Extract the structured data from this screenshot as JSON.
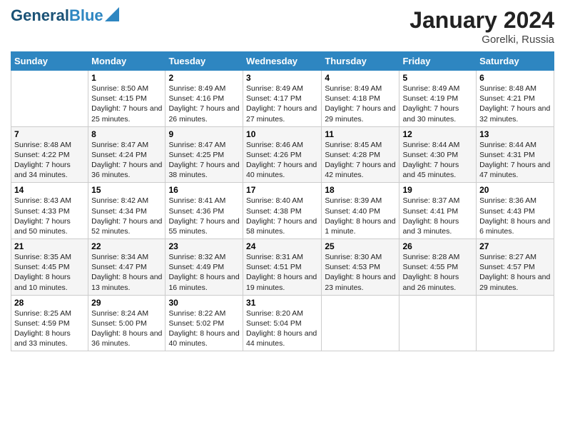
{
  "header": {
    "logo_line1": "General",
    "logo_line2": "Blue",
    "title": "January 2024",
    "subtitle": "Gorelki, Russia"
  },
  "days": [
    "Sunday",
    "Monday",
    "Tuesday",
    "Wednesday",
    "Thursday",
    "Friday",
    "Saturday"
  ],
  "weeks": [
    [
      {
        "date": "",
        "sunrise": "",
        "sunset": "",
        "daylight": ""
      },
      {
        "date": "1",
        "sunrise": "Sunrise: 8:50 AM",
        "sunset": "Sunset: 4:15 PM",
        "daylight": "Daylight: 7 hours and 25 minutes."
      },
      {
        "date": "2",
        "sunrise": "Sunrise: 8:49 AM",
        "sunset": "Sunset: 4:16 PM",
        "daylight": "Daylight: 7 hours and 26 minutes."
      },
      {
        "date": "3",
        "sunrise": "Sunrise: 8:49 AM",
        "sunset": "Sunset: 4:17 PM",
        "daylight": "Daylight: 7 hours and 27 minutes."
      },
      {
        "date": "4",
        "sunrise": "Sunrise: 8:49 AM",
        "sunset": "Sunset: 4:18 PM",
        "daylight": "Daylight: 7 hours and 29 minutes."
      },
      {
        "date": "5",
        "sunrise": "Sunrise: 8:49 AM",
        "sunset": "Sunset: 4:19 PM",
        "daylight": "Daylight: 7 hours and 30 minutes."
      },
      {
        "date": "6",
        "sunrise": "Sunrise: 8:48 AM",
        "sunset": "Sunset: 4:21 PM",
        "daylight": "Daylight: 7 hours and 32 minutes."
      }
    ],
    [
      {
        "date": "7",
        "sunrise": "Sunrise: 8:48 AM",
        "sunset": "Sunset: 4:22 PM",
        "daylight": "Daylight: 7 hours and 34 minutes."
      },
      {
        "date": "8",
        "sunrise": "Sunrise: 8:47 AM",
        "sunset": "Sunset: 4:24 PM",
        "daylight": "Daylight: 7 hours and 36 minutes."
      },
      {
        "date": "9",
        "sunrise": "Sunrise: 8:47 AM",
        "sunset": "Sunset: 4:25 PM",
        "daylight": "Daylight: 7 hours and 38 minutes."
      },
      {
        "date": "10",
        "sunrise": "Sunrise: 8:46 AM",
        "sunset": "Sunset: 4:26 PM",
        "daylight": "Daylight: 7 hours and 40 minutes."
      },
      {
        "date": "11",
        "sunrise": "Sunrise: 8:45 AM",
        "sunset": "Sunset: 4:28 PM",
        "daylight": "Daylight: 7 hours and 42 minutes."
      },
      {
        "date": "12",
        "sunrise": "Sunrise: 8:44 AM",
        "sunset": "Sunset: 4:30 PM",
        "daylight": "Daylight: 7 hours and 45 minutes."
      },
      {
        "date": "13",
        "sunrise": "Sunrise: 8:44 AM",
        "sunset": "Sunset: 4:31 PM",
        "daylight": "Daylight: 7 hours and 47 minutes."
      }
    ],
    [
      {
        "date": "14",
        "sunrise": "Sunrise: 8:43 AM",
        "sunset": "Sunset: 4:33 PM",
        "daylight": "Daylight: 7 hours and 50 minutes."
      },
      {
        "date": "15",
        "sunrise": "Sunrise: 8:42 AM",
        "sunset": "Sunset: 4:34 PM",
        "daylight": "Daylight: 7 hours and 52 minutes."
      },
      {
        "date": "16",
        "sunrise": "Sunrise: 8:41 AM",
        "sunset": "Sunset: 4:36 PM",
        "daylight": "Daylight: 7 hours and 55 minutes."
      },
      {
        "date": "17",
        "sunrise": "Sunrise: 8:40 AM",
        "sunset": "Sunset: 4:38 PM",
        "daylight": "Daylight: 7 hours and 58 minutes."
      },
      {
        "date": "18",
        "sunrise": "Sunrise: 8:39 AM",
        "sunset": "Sunset: 4:40 PM",
        "daylight": "Daylight: 8 hours and 1 minute."
      },
      {
        "date": "19",
        "sunrise": "Sunrise: 8:37 AM",
        "sunset": "Sunset: 4:41 PM",
        "daylight": "Daylight: 8 hours and 3 minutes."
      },
      {
        "date": "20",
        "sunrise": "Sunrise: 8:36 AM",
        "sunset": "Sunset: 4:43 PM",
        "daylight": "Daylight: 8 hours and 6 minutes."
      }
    ],
    [
      {
        "date": "21",
        "sunrise": "Sunrise: 8:35 AM",
        "sunset": "Sunset: 4:45 PM",
        "daylight": "Daylight: 8 hours and 10 minutes."
      },
      {
        "date": "22",
        "sunrise": "Sunrise: 8:34 AM",
        "sunset": "Sunset: 4:47 PM",
        "daylight": "Daylight: 8 hours and 13 minutes."
      },
      {
        "date": "23",
        "sunrise": "Sunrise: 8:32 AM",
        "sunset": "Sunset: 4:49 PM",
        "daylight": "Daylight: 8 hours and 16 minutes."
      },
      {
        "date": "24",
        "sunrise": "Sunrise: 8:31 AM",
        "sunset": "Sunset: 4:51 PM",
        "daylight": "Daylight: 8 hours and 19 minutes."
      },
      {
        "date": "25",
        "sunrise": "Sunrise: 8:30 AM",
        "sunset": "Sunset: 4:53 PM",
        "daylight": "Daylight: 8 hours and 23 minutes."
      },
      {
        "date": "26",
        "sunrise": "Sunrise: 8:28 AM",
        "sunset": "Sunset: 4:55 PM",
        "daylight": "Daylight: 8 hours and 26 minutes."
      },
      {
        "date": "27",
        "sunrise": "Sunrise: 8:27 AM",
        "sunset": "Sunset: 4:57 PM",
        "daylight": "Daylight: 8 hours and 29 minutes."
      }
    ],
    [
      {
        "date": "28",
        "sunrise": "Sunrise: 8:25 AM",
        "sunset": "Sunset: 4:59 PM",
        "daylight": "Daylight: 8 hours and 33 minutes."
      },
      {
        "date": "29",
        "sunrise": "Sunrise: 8:24 AM",
        "sunset": "Sunset: 5:00 PM",
        "daylight": "Daylight: 8 hours and 36 minutes."
      },
      {
        "date": "30",
        "sunrise": "Sunrise: 8:22 AM",
        "sunset": "Sunset: 5:02 PM",
        "daylight": "Daylight: 8 hours and 40 minutes."
      },
      {
        "date": "31",
        "sunrise": "Sunrise: 8:20 AM",
        "sunset": "Sunset: 5:04 PM",
        "daylight": "Daylight: 8 hours and 44 minutes."
      },
      {
        "date": "",
        "sunrise": "",
        "sunset": "",
        "daylight": ""
      },
      {
        "date": "",
        "sunrise": "",
        "sunset": "",
        "daylight": ""
      },
      {
        "date": "",
        "sunrise": "",
        "sunset": "",
        "daylight": ""
      }
    ]
  ]
}
